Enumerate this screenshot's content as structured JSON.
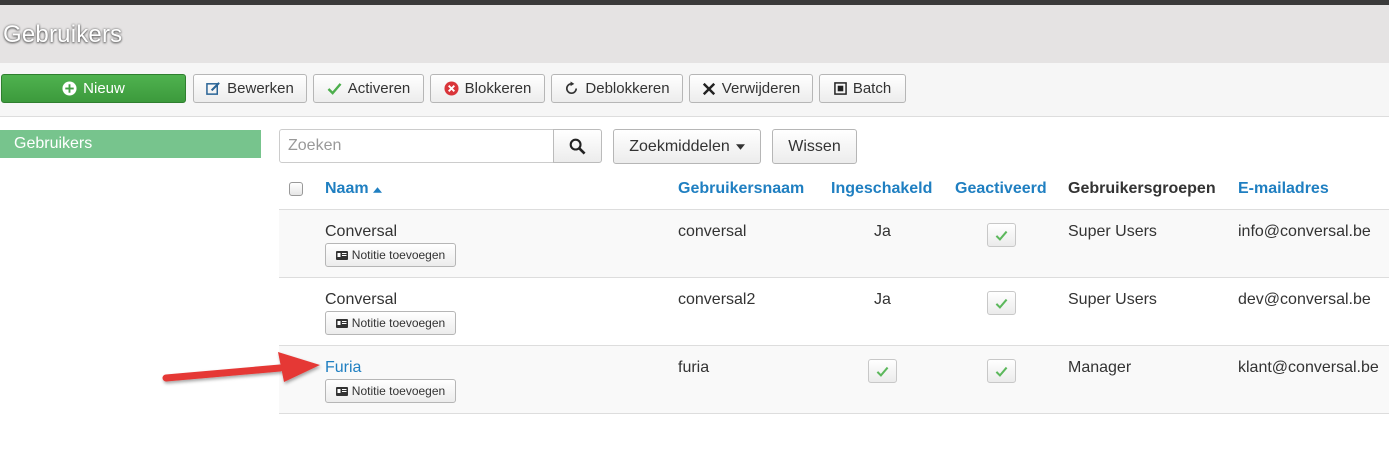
{
  "header": {
    "title": "Gebruikers"
  },
  "toolbar": {
    "new_label": "Nieuw",
    "edit_label": "Bewerken",
    "activate_label": "Activeren",
    "block_label": "Blokkeren",
    "unblock_label": "Deblokkeren",
    "delete_label": "Verwijderen",
    "batch_label": "Batch"
  },
  "sidebar": {
    "items": [
      {
        "label": "Gebruikers",
        "active": true
      }
    ]
  },
  "filters": {
    "search_placeholder": "Zoeken",
    "search_value": "",
    "tools_label": "Zoekmiddelen",
    "clear_label": "Wissen"
  },
  "table": {
    "columns": {
      "name": "Naam",
      "username": "Gebruikersnaam",
      "enabled": "Ingeschakeld",
      "activated": "Geactiveerd",
      "groups": "Gebruikersgroepen",
      "email": "E-mailadres"
    },
    "sort": {
      "column": "name",
      "direction": "asc"
    },
    "rows": [
      {
        "name": "Conversal",
        "note_label": "Notitie toevoegen",
        "username": "conversal",
        "enabled": "Ja",
        "activated": "check",
        "group": "Super Users",
        "email": "info@conversal.be"
      },
      {
        "name": "Conversal",
        "note_label": "Notitie toevoegen",
        "username": "conversal2",
        "enabled": "Ja",
        "activated": "check",
        "group": "Super Users",
        "email": "dev@conversal.be"
      },
      {
        "name": "Furia",
        "note_label": "Notitie toevoegen",
        "username": "furia",
        "enabled": "check",
        "activated": "check",
        "group": "Manager",
        "email": "klant@conversal.be"
      }
    ]
  },
  "colors": {
    "accent_link": "#1f7fc1",
    "success_button": "#45a845",
    "sidebar_active": "#77c48d",
    "annotation_arrow": "#e53935",
    "check_green": "#5cb85c"
  },
  "icons": {
    "new": "plus-circle-icon",
    "edit": "edit-icon",
    "activate": "check-icon",
    "block": "x-circle-icon",
    "unblock": "refresh-icon",
    "delete": "x-icon",
    "batch": "square-icon",
    "search": "search-icon",
    "note": "id-card-icon"
  }
}
